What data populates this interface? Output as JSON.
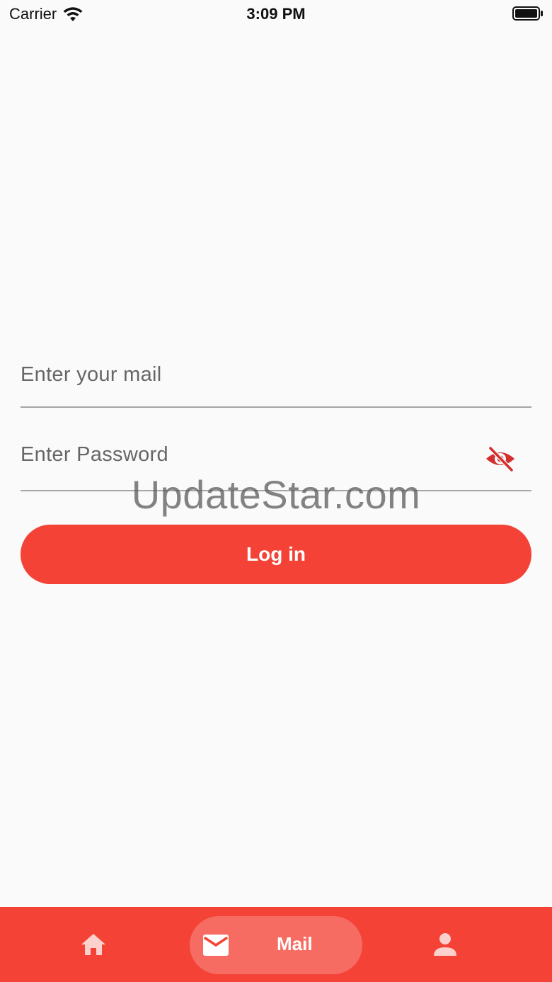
{
  "status_bar": {
    "carrier": "Carrier",
    "time": "3:09 PM",
    "wifi_icon": "wifi-icon",
    "battery_icon": "battery-icon"
  },
  "form": {
    "email": {
      "placeholder": "Enter your mail",
      "value": ""
    },
    "password": {
      "placeholder": "Enter Password",
      "value": "",
      "visibility_icon": "eye-off-icon"
    },
    "login_button_label": "Log in"
  },
  "watermark": "UpdateStar.com",
  "bottom_nav": {
    "items": [
      {
        "icon": "home-icon",
        "label": ""
      },
      {
        "icon": "mail-icon",
        "label": "Mail",
        "selected": true
      },
      {
        "icon": "person-icon",
        "label": ""
      }
    ]
  },
  "colors": {
    "accent": "#f44336",
    "background": "#fafafa",
    "icon_red": "#d32f2f"
  }
}
